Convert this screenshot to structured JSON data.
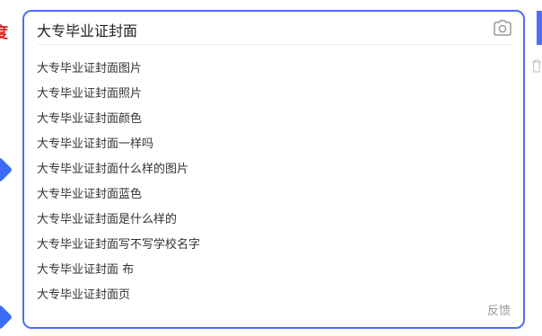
{
  "page_fragment": {
    "left_text": "度"
  },
  "search_suggest": {
    "query": "大专毕业证封面",
    "suggestions": [
      "大专毕业证封面图片",
      "大专毕业证封面照片",
      "大专毕业证封面颜色",
      "大专毕业证封面一样吗",
      "大专毕业证封面什么样的图片",
      "大专毕业证封面蓝色",
      "大专毕业证封面是什么样的",
      "大专毕业证封面写不写学校名字",
      "大专毕业证封面 布",
      "大专毕业证封面页"
    ],
    "feedback_label": "反馈",
    "camera_icon": "camera-icon"
  },
  "colors": {
    "accent": "#4e6ef2",
    "brand_red": "#e02020",
    "text": "#333333",
    "muted": "#999999"
  }
}
